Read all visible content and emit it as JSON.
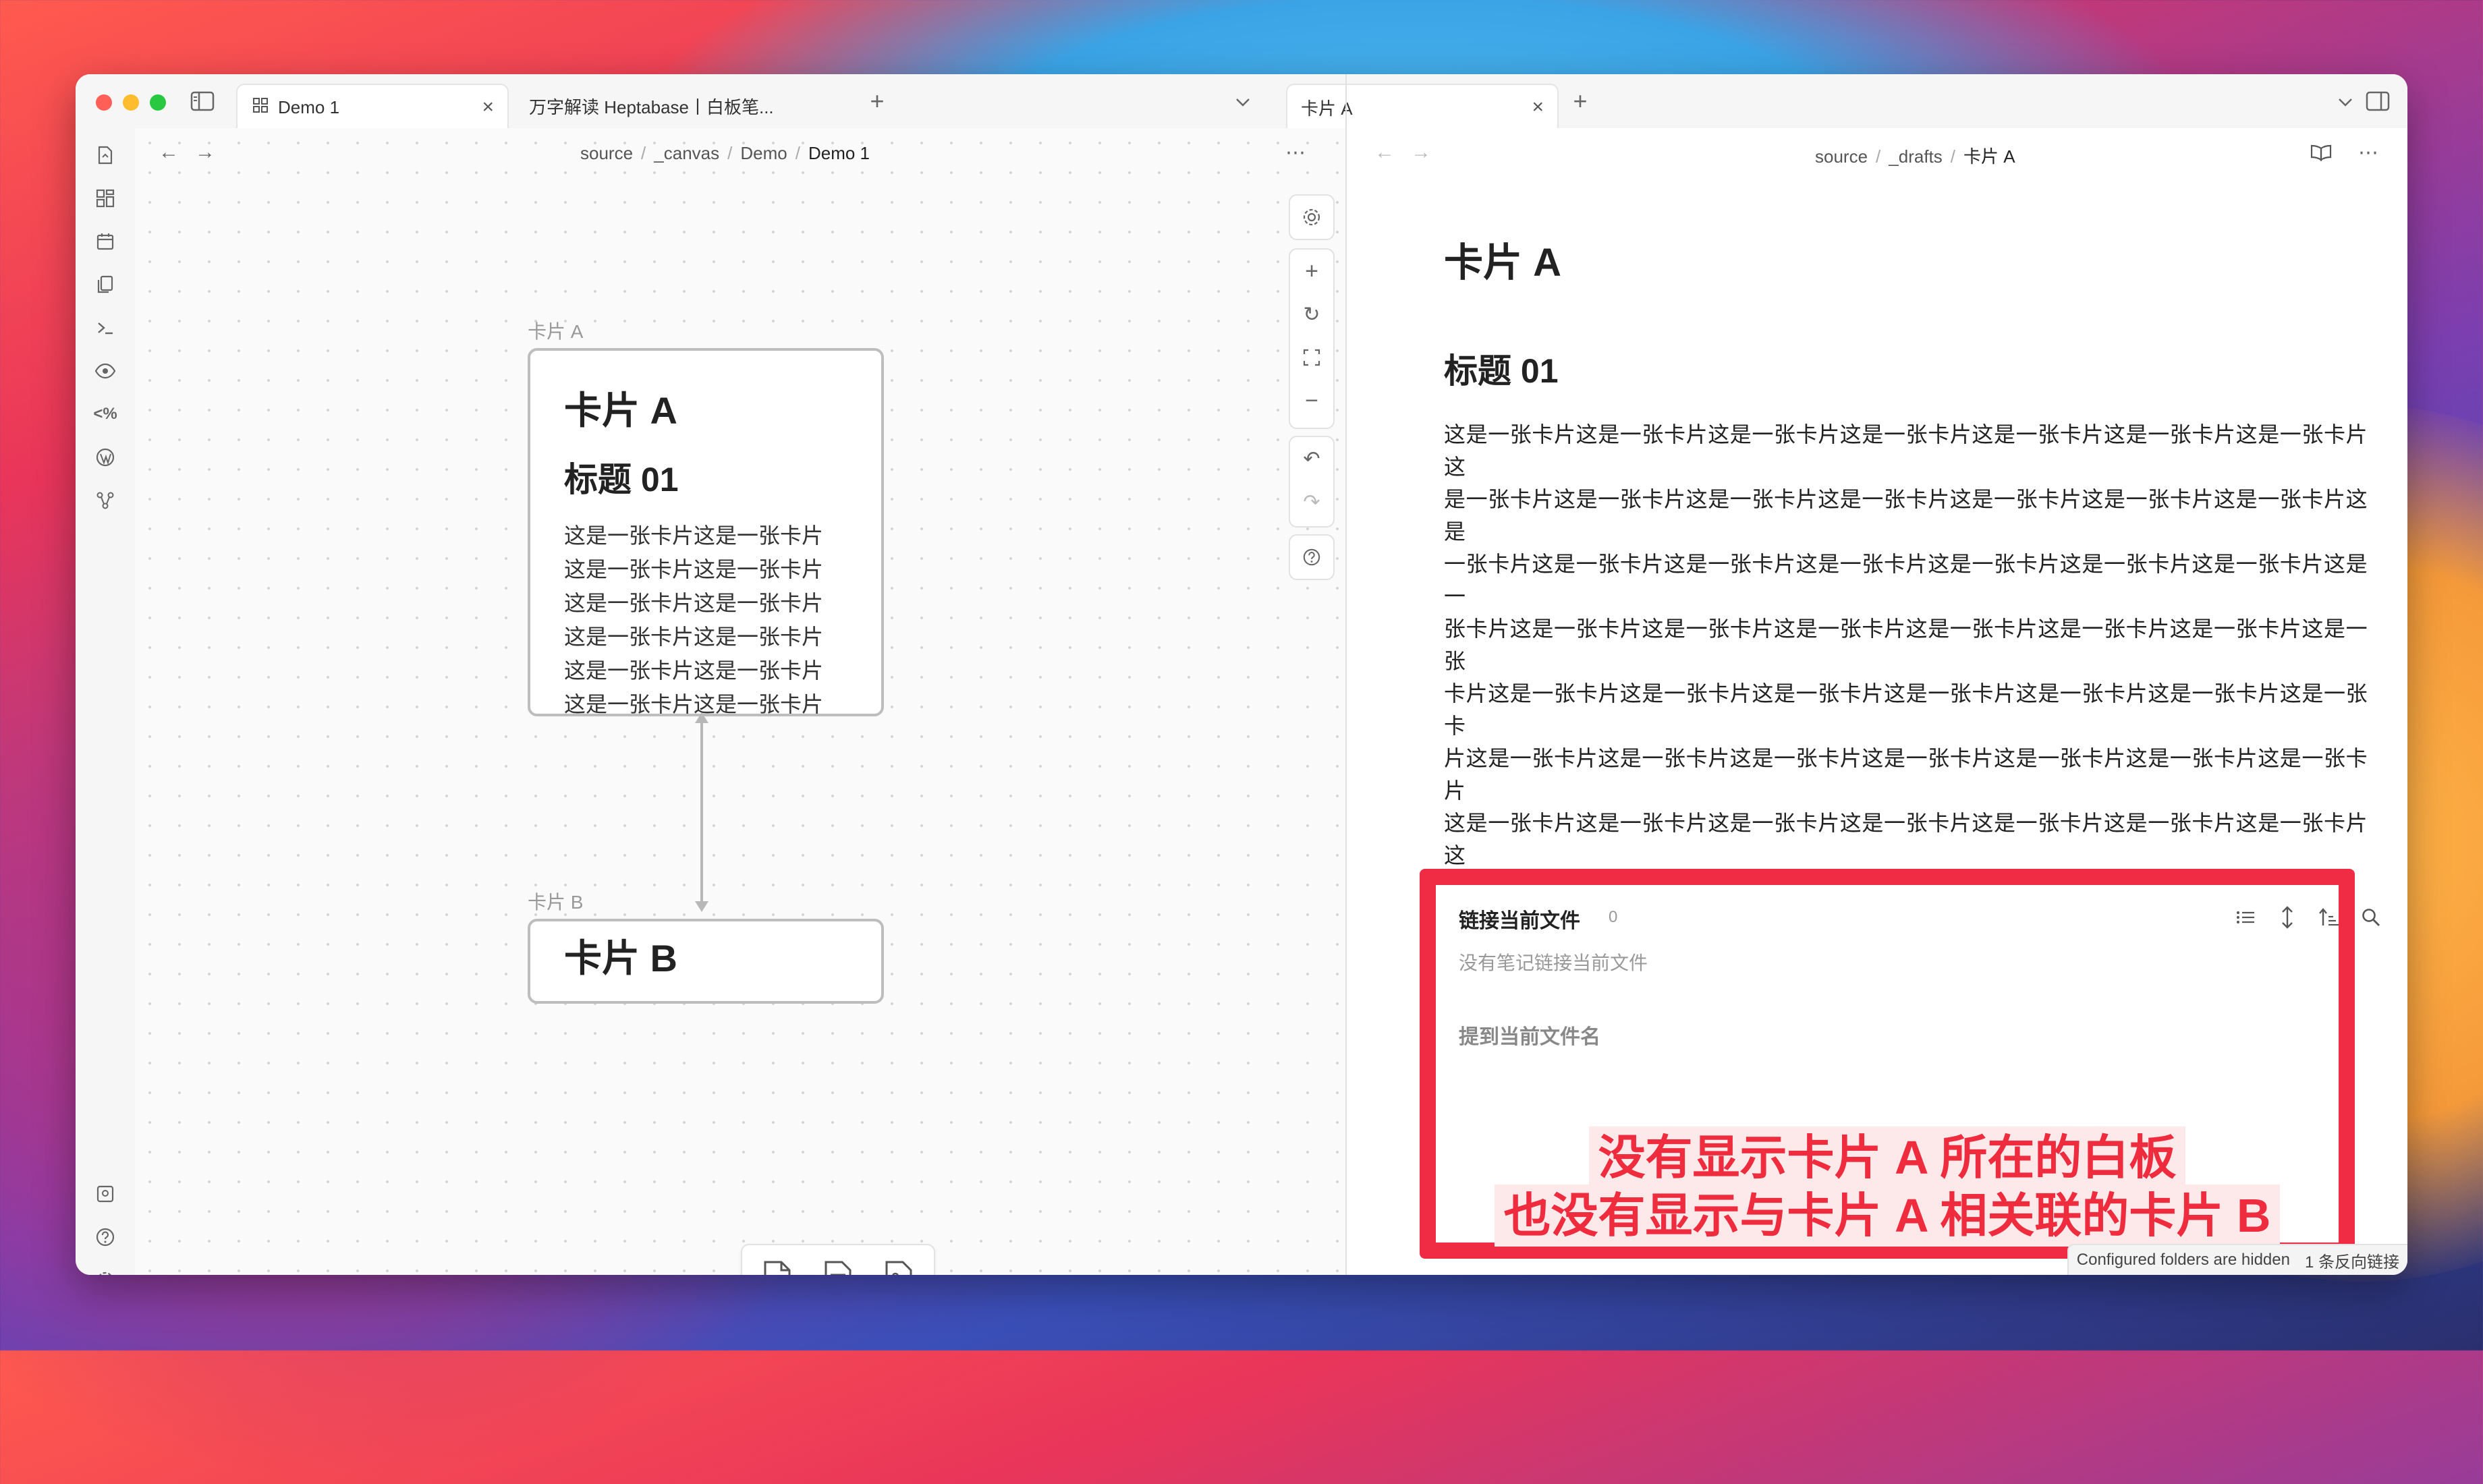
{
  "tabs_left": [
    {
      "label": "Demo 1",
      "icon": "canvas-icon",
      "active": true
    },
    {
      "label": "万字解读 Heptabase丨白板笔...",
      "active": false
    }
  ],
  "tabs_right": [
    {
      "label": "卡片 A",
      "active": true
    }
  ],
  "left_breadcrumb": [
    "source",
    "_canvas",
    "Demo",
    "Demo 1"
  ],
  "right_breadcrumb": [
    "source",
    "_drafts",
    "卡片 A"
  ],
  "ribbon_icons": [
    "open-file-icon",
    "dashboard-icon",
    "calendar-icon",
    "copy-icon",
    "terminal-icon",
    "eye-icon",
    "code-percent-icon",
    "wordpress-icon",
    "graph-icon"
  ],
  "ribbon_bottom_icons": [
    "vault-icon",
    "help-icon",
    "settings-icon"
  ],
  "canvas": {
    "card_a": {
      "label": "卡片 A",
      "title": "卡片 A",
      "heading": "标题 01",
      "lines": [
        "这是一张卡片这是一张卡片",
        "这是一张卡片这是一张卡片",
        "这是一张卡片这是一张卡片",
        "这是一张卡片这是一张卡片",
        "这是一张卡片这是一张卡片",
        "这是一张卡片这是一张卡片"
      ]
    },
    "card_b": {
      "label": "卡片 B",
      "title": "卡片 B"
    },
    "controls": [
      "settings-icon",
      "zoom-in-icon",
      "reset-zoom-icon",
      "fit-icon",
      "zoom-out-icon",
      "undo-icon",
      "redo-icon",
      "help-icon"
    ],
    "bottom_tools": [
      "new-card-icon",
      "add-note-icon",
      "add-media-icon"
    ]
  },
  "note": {
    "title": "卡片 A",
    "heading": "标题 01",
    "lines": [
      "这是一张卡片这是一张卡片这是一张卡片这是一张卡片这是一张卡片这是一张卡片这是一张卡片这",
      "是一张卡片这是一张卡片这是一张卡片这是一张卡片这是一张卡片这是一张卡片这是一张卡片这是",
      "一张卡片这是一张卡片这是一张卡片这是一张卡片这是一张卡片这是一张卡片这是一张卡片这是一",
      "张卡片这是一张卡片这是一张卡片这是一张卡片这是一张卡片这是一张卡片这是一张卡片这是一张",
      "卡片这是一张卡片这是一张卡片这是一张卡片这是一张卡片这是一张卡片这是一张卡片这是一张卡",
      "片这是一张卡片这是一张卡片这是一张卡片这是一张卡片这是一张卡片这是一张卡片这是一张卡片",
      "这是一张卡片这是一张卡片这是一张卡片这是一张卡片这是一张卡片这是一张卡片这是一张卡片这"
    ]
  },
  "backlinks": {
    "title": "链接当前文件",
    "count": "0",
    "empty_text": "没有笔记链接当前文件",
    "mentions_title": "提到当前文件名",
    "annotation_line1": "没有显示卡片 A 所在的白板",
    "annotation_line2": "也没有显示与卡片 A 相关联的卡片 B",
    "annotation_color": "#ef2b3e"
  },
  "status_bar": {
    "folders": "Configured folders are hidden",
    "backlinks": "1 条反向链接"
  }
}
